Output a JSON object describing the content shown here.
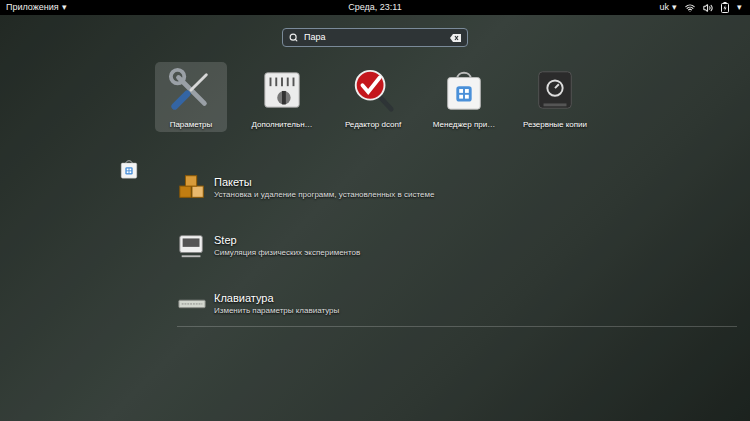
{
  "top_bar": {
    "activities": "Приложения",
    "activities_arrow": "▾",
    "clock": "Среда, 23:11",
    "keyboard_layout": "uk",
    "keyboard_arrow": "▾",
    "system_arrow": "▾"
  },
  "search": {
    "query": "Пара"
  },
  "apps": [
    {
      "label": "Параметры",
      "selected": true
    },
    {
      "label": "Дополнительн…",
      "selected": false
    },
    {
      "label": "Редактор dconf",
      "selected": false
    },
    {
      "label": "Менеджер при…",
      "selected": false
    },
    {
      "label": "Резервные копии",
      "selected": false
    }
  ],
  "search_results": [
    {
      "title": "Пакеты",
      "description": "Установка и удаление программ, установленных в системе"
    },
    {
      "title": "Step",
      "description": "Симуляция физических экспериментов"
    },
    {
      "title": "Клавиатура",
      "description": "Изменить параметры клавиатуры"
    }
  ]
}
